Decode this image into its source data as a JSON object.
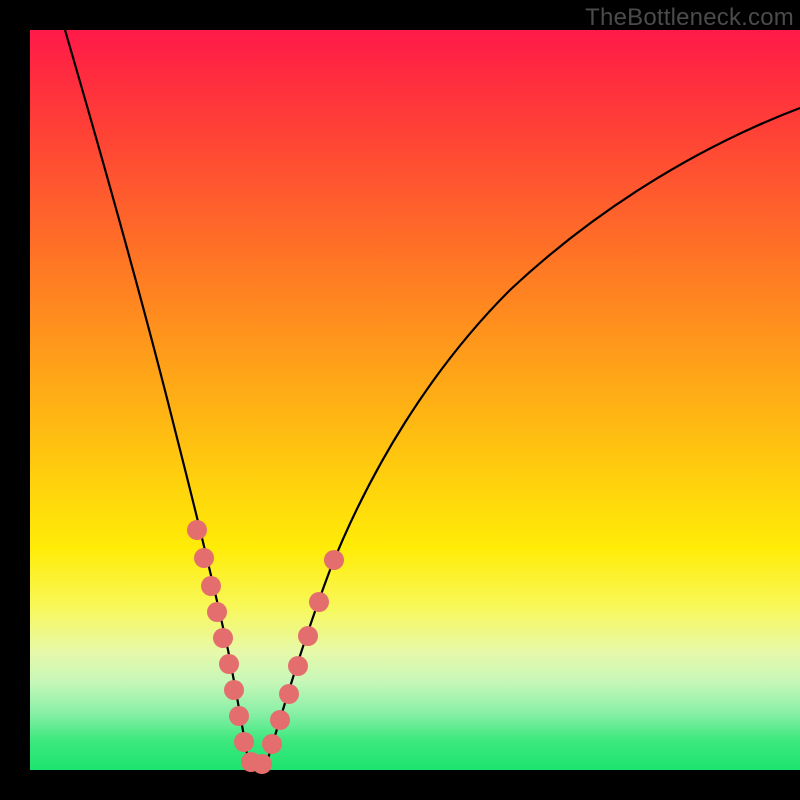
{
  "watermark": "TheBottleneck.com",
  "chart_data": {
    "type": "line",
    "title": "",
    "xlabel": "",
    "ylabel": "",
    "xlim": [
      0,
      100
    ],
    "ylim": [
      0,
      100
    ],
    "notes": "V-shaped bottleneck curve over red-to-green vertical gradient; no axis ticks or numeric labels are shown. Values below are pixel-relative estimates (0–100 on each axis) read from the plot.",
    "series": [
      {
        "name": "bottleneck-curve",
        "x": [
          4,
          8,
          12,
          16,
          19,
          22,
          24,
          26,
          27,
          28,
          30,
          33,
          38,
          45,
          55,
          68,
          82,
          100
        ],
        "y": [
          100,
          82,
          64,
          48,
          34,
          22,
          13,
          6,
          2,
          0,
          2,
          8,
          20,
          36,
          54,
          70,
          82,
          90
        ]
      }
    ],
    "highlight_points": {
      "name": "pink-dots",
      "comment": "clustered near the valley on both arms, roughly y ∈ [0, 32]",
      "left_arm": [
        [
          19,
          32
        ],
        [
          20,
          28
        ],
        [
          21,
          24
        ],
        [
          22,
          20
        ],
        [
          23,
          16
        ],
        [
          24,
          12
        ],
        [
          25,
          8
        ],
        [
          26,
          5
        ],
        [
          27,
          2
        ]
      ],
      "valley": [
        [
          28,
          0
        ],
        [
          29,
          0
        ],
        [
          30,
          1
        ]
      ],
      "right_arm": [
        [
          31,
          3
        ],
        [
          32,
          6
        ],
        [
          33,
          9
        ],
        [
          34,
          13
        ],
        [
          35,
          17
        ],
        [
          36,
          22
        ],
        [
          38,
          30
        ]
      ]
    },
    "gradient_stops": [
      {
        "pos": 0,
        "color": "#ff1a49"
      },
      {
        "pos": 50,
        "color": "#ffbb12"
      },
      {
        "pos": 80,
        "color": "#f8f85a"
      },
      {
        "pos": 100,
        "color": "#1de46e"
      }
    ]
  }
}
